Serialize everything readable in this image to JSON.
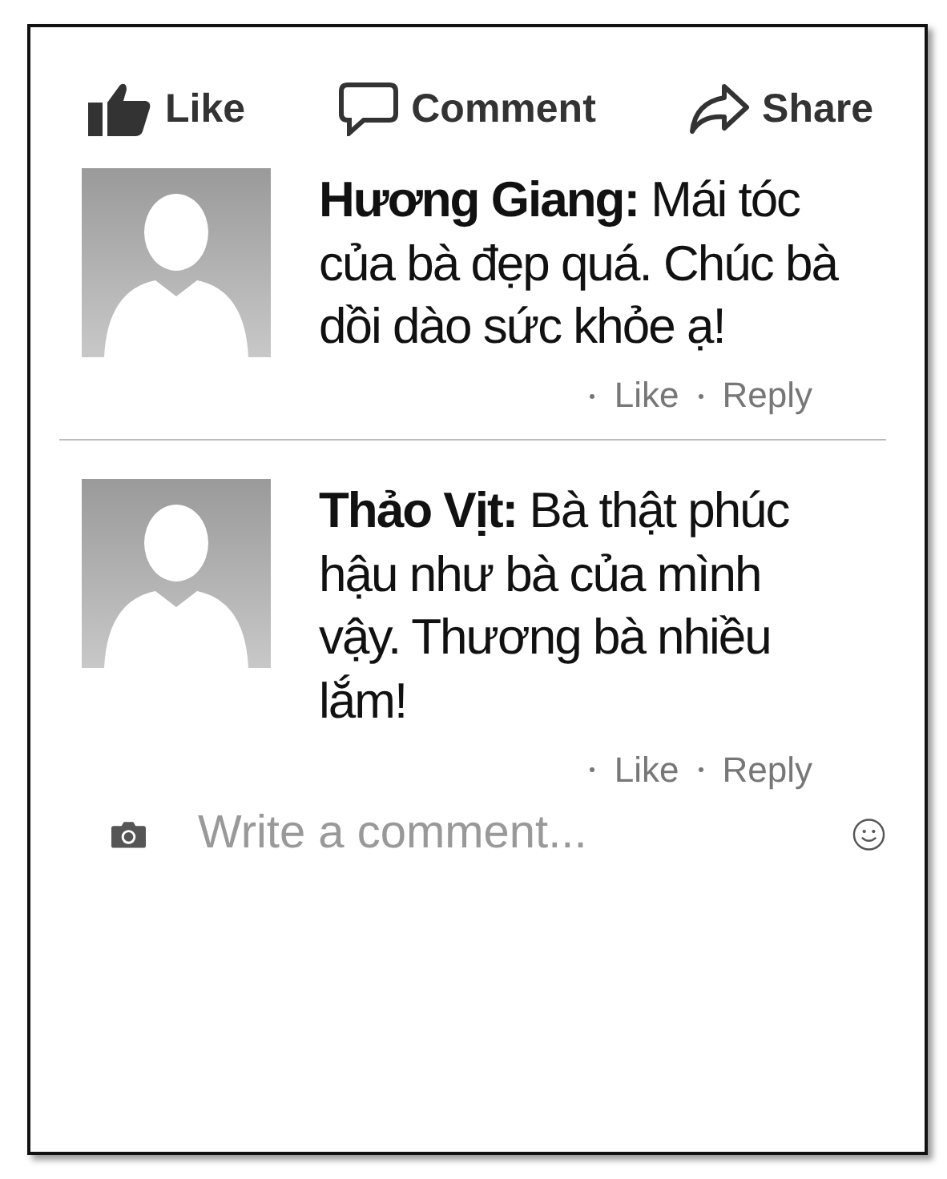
{
  "actions": [
    {
      "kind": "like",
      "label": "Like"
    },
    {
      "kind": "comment",
      "label": "Comment"
    },
    {
      "kind": "share",
      "label": "Share"
    }
  ],
  "comments": [
    {
      "text": "**Hương Giang:** Mái tóc của bà đẹp quá. Chúc bà dồi dào sức khỏe ạ!",
      "like": "Like",
      "reply": "Reply"
    },
    {
      "text": "**Thảo Vịt:** Bà thật phúc hậu như bà của mình vậy. Thương bà nhiều lắm!",
      "like": "Like",
      "reply": "Reply"
    }
  ],
  "composer": {
    "placeholder": "Write a comment..."
  }
}
